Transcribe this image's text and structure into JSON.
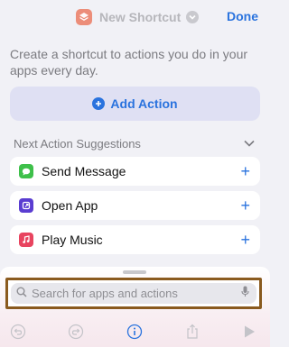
{
  "header": {
    "title": "New Shortcut",
    "done_label": "Done",
    "app_icon": "shortcuts-stack-icon"
  },
  "intro_text": "Create a shortcut to actions you do in your apps every day.",
  "add_action": {
    "label": "Add Action"
  },
  "suggestions": {
    "title": "Next Action Suggestions",
    "items": [
      {
        "label": "Send Message",
        "icon": "messages-icon",
        "color": "#3ec04a"
      },
      {
        "label": "Open App",
        "icon": "open-app-icon",
        "color": "#5a3dd1"
      },
      {
        "label": "Play Music",
        "icon": "music-icon",
        "color": "#e8445f"
      }
    ]
  },
  "search": {
    "placeholder": "Search for apps and actions"
  },
  "toolbar": {
    "items": [
      "undo-icon",
      "redo-icon",
      "info-icon",
      "share-icon",
      "play-icon"
    ]
  },
  "colors": {
    "accent": "#2a73de",
    "background": "#f1f1f6",
    "highlight_border": "#8a5a1e"
  }
}
